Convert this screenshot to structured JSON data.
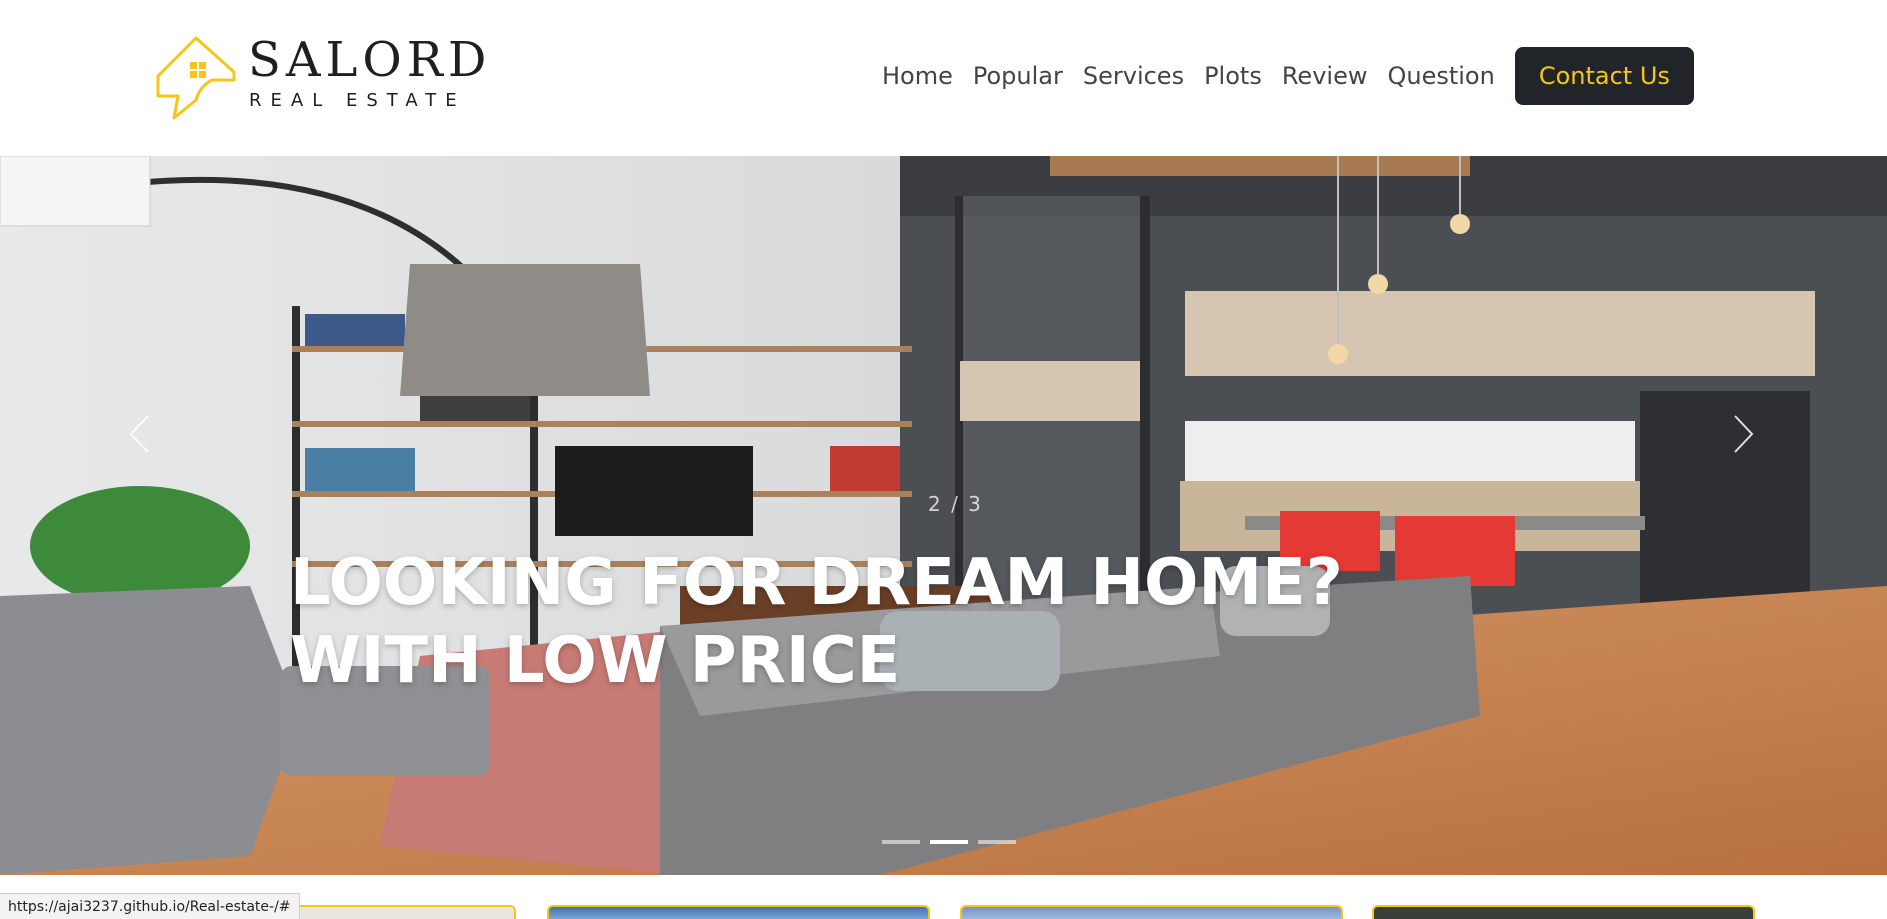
{
  "brand": {
    "name": "SALORD",
    "tagline": "REAL ESTATE",
    "accent_color": "#f5c518",
    "dark_color": "#212529"
  },
  "nav": {
    "items": [
      {
        "label": "Home"
      },
      {
        "label": "Popular"
      },
      {
        "label": "Services"
      },
      {
        "label": "Plots"
      },
      {
        "label": "Review"
      },
      {
        "label": "Question"
      }
    ],
    "cta_label": "Contact Us"
  },
  "hero": {
    "title_line1": "LOOKING FOR DREAM HOME?",
    "title_line2": "WITH LOW PRICE",
    "pagination": "2 / 3",
    "current_slide": 2,
    "total_slides": 3,
    "prev_icon": "chevron-left-icon",
    "next_icon": "chevron-right-icon"
  },
  "cards": {
    "count": 4,
    "border_color": "#f5c518"
  },
  "status_bar": {
    "url": "https://ajai3237.github.io/Real-estate-/#"
  }
}
